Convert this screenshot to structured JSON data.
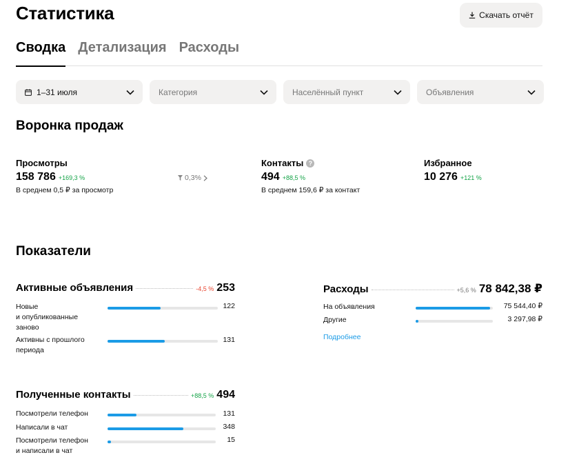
{
  "header": {
    "title": "Статистика",
    "download_label": "Скачать отчёт"
  },
  "tabs": [
    {
      "label": "Сводка",
      "active": true
    },
    {
      "label": "Детализация",
      "active": false
    },
    {
      "label": "Расходы",
      "active": false
    }
  ],
  "filters": {
    "period": "1–31 июля",
    "category": "Категория",
    "locality": "Населённый пункт",
    "listings": "Объявления"
  },
  "funnel": {
    "title": "Воронка продаж",
    "views": {
      "label": "Просмотры",
      "value": "158 786",
      "delta": "+169,3 %",
      "sub": "В среднем 0,5 ₽ за просмотр"
    },
    "conversion": "0,3%",
    "contacts": {
      "label": "Контакты",
      "value": "494",
      "delta": "+88,5 %",
      "sub": "В среднем 159,6 ₽ за контакт"
    },
    "favorites": {
      "label": "Избранное",
      "value": "10 276",
      "delta": "+121 %"
    }
  },
  "indicators": {
    "title": "Показатели",
    "active_listings": {
      "name": "Активные объявления",
      "delta": "-4,5 %",
      "total": "253",
      "rows": [
        {
          "label_l1": "Новые",
          "label_l2": "и опубликованные",
          "label_l3": "заново",
          "value": "122",
          "fraction": 0.48
        },
        {
          "label_l1": "Активны с прошлого",
          "label_l2": "периода",
          "value": "131",
          "fraction": 0.52
        }
      ]
    },
    "expenses": {
      "name": "Расходы",
      "delta": "+5,6 %",
      "total": "78 842,38 ₽",
      "rows": [
        {
          "label": "На объявления",
          "value": "75 544,40 ₽",
          "fraction": 0.96
        },
        {
          "label": "Другие",
          "value": "3 297,98 ₽",
          "fraction": 0.04
        }
      ],
      "more_link": "Подробнее"
    },
    "received_contacts": {
      "name": "Полученные контакты",
      "delta": "+88,5 %",
      "total": "494",
      "rows": [
        {
          "label_l1": "Посмотрели телефон",
          "value": "131",
          "fraction": 0.27
        },
        {
          "label_l1": "Написали в чат",
          "value": "348",
          "fraction": 0.7
        },
        {
          "label_l1": "Посмотрели телефон",
          "label_l2": "и написали в чат",
          "value": "15",
          "fraction": 0.03
        }
      ]
    }
  },
  "colors": {
    "accent_blue": "#1b9be6",
    "positive": "#14a347",
    "negative": "#e8442f"
  }
}
